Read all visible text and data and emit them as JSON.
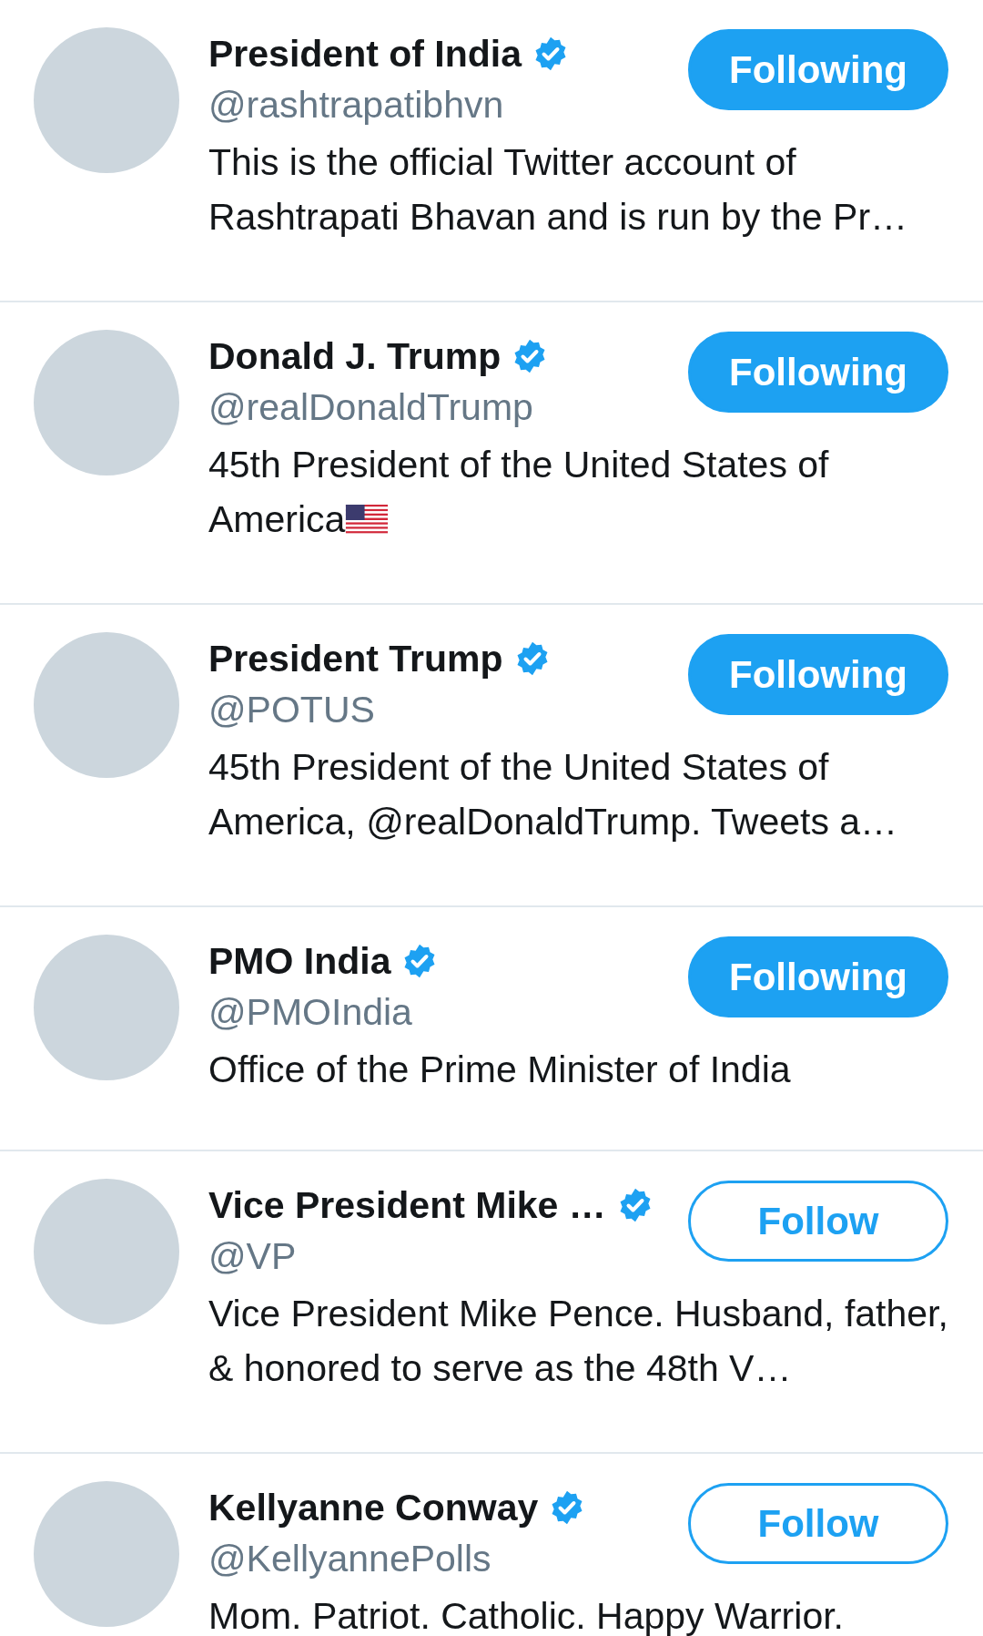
{
  "users": [
    {
      "name": "President of India",
      "verified": true,
      "handle": "@rashtrapatibhvn",
      "button": "Following",
      "following": true,
      "bio": "This is the official Twitter account of Rashtrapati Bhavan and is run by the Pr…"
    },
    {
      "name": "Donald J. Trump",
      "verified": true,
      "handle": "@realDonaldTrump",
      "button": "Following",
      "following": true,
      "bio": "45th President of the United States of America",
      "bio_flag": true
    },
    {
      "name": "President Trump",
      "verified": true,
      "handle": "@POTUS",
      "button": "Following",
      "following": true,
      "bio": "45th President of the United States of America, @realDonaldTrump. Tweets a…"
    },
    {
      "name": "PMO India",
      "verified": true,
      "handle": "@PMOIndia",
      "button": "Following",
      "following": true,
      "bio": "Office of the Prime Minister of India"
    },
    {
      "name": "Vice President Mike …",
      "verified": true,
      "handle": "@VP",
      "button": "Follow",
      "following": false,
      "bio": "Vice President Mike Pence. Husband, father, & honored to serve as the 48th V…"
    },
    {
      "name": "Kellyanne Conway",
      "verified": true,
      "handle": "@KellyannePolls",
      "button": "Follow",
      "following": false,
      "bio": "Mom. Patriot. Catholic. Happy Warrior."
    }
  ]
}
